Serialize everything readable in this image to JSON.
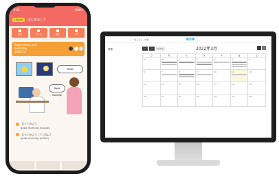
{
  "phone": {
    "status_time": "9:41",
    "status_right": "100%",
    "header_badge": "Lesson",
    "header_title": "はじめまして",
    "toolbar": [
      "学習",
      "クイズ",
      "復習",
      "メモ"
    ],
    "lesson_title_line1": "Expressions and",
    "lesson_title_line2": "everyday",
    "lesson_title_line3": "patterns",
    "bubble_left": "Good morning!",
    "bubble_right": "Hello!",
    "line1_jp": "言ってみよう",
    "line1_en": "good morning (casual)",
    "line2_jp": "言ってみよう（ていねい）",
    "line2_en": "good morning (polite)",
    "colors": {
      "header": "#f26a63",
      "tool": "#f57d5a",
      "lesson": "#f5a037"
    }
  },
  "monitor": {
    "crumb": "< 一覧に戻る / 授業",
    "tag": "編集",
    "sidebar_label": "授業",
    "today_label": "today",
    "month_title": "2022年3月",
    "weekdays": [
      "日",
      "月",
      "火",
      "水",
      "木",
      "金",
      "土"
    ],
    "weeks": [
      [
        "27",
        "28",
        "1",
        "2",
        "3",
        "4",
        "5"
      ],
      [
        "6",
        "7",
        "8",
        "9",
        "10",
        "11",
        "12"
      ],
      [
        "13",
        "14",
        "15",
        "16",
        "17",
        "18",
        "19"
      ],
      [
        "20",
        "21",
        "22",
        "23",
        "24",
        "25",
        "26"
      ]
    ]
  }
}
